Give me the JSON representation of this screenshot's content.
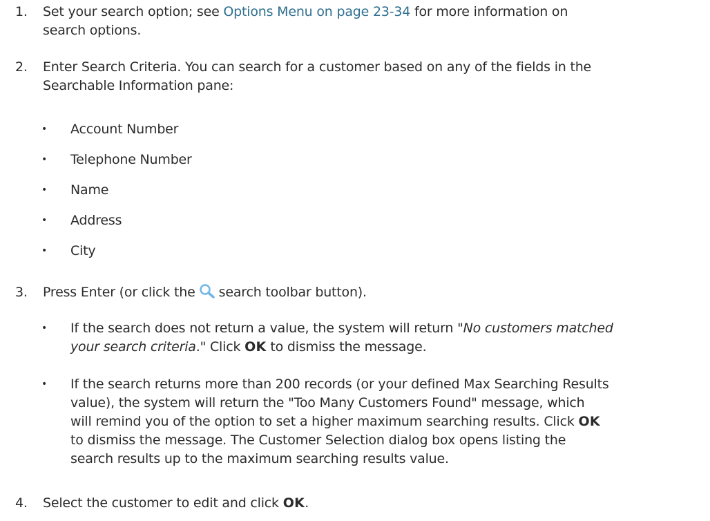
{
  "steps": [
    {
      "num": "1.",
      "before_link": "Set your search option; see ",
      "link": "Options Menu on page 23-34",
      "after_link": " for more information on",
      "line2": "search options."
    },
    {
      "num": "2.",
      "line1": "Enter Search Criteria. You can search for a customer based on any of the fields in the",
      "line2": "Searchable Information pane:",
      "bullets": [
        "Account Number",
        "Telephone Number",
        "Name",
        "Address",
        "City"
      ]
    },
    {
      "num": "3.",
      "before_icon": "Press Enter (or click the",
      "after_icon": "search toolbar button).",
      "icon": "search-icon",
      "sub_a": {
        "pre": "If the search does not return a value, the system will return ",
        "italic_1": "\"No customers matched",
        "italic_2": "your search criteria",
        "post": ".\" Click ",
        "ok": "OK",
        "end": " to dismiss the message."
      },
      "sub_b": {
        "line1": "If the search returns more than 200 records (or your defined Max Searching Results",
        "line2": "value), the system will return the \"Too Many Customers Found\" message, which",
        "line3_pre": "will remind you of the option to set a higher maximum searching results. Click ",
        "ok": "OK",
        "line4_pre": "to dismiss the message. The Customer Selection dialog box opens listing the",
        "line5": "search results up to the maximum searching results value."
      }
    },
    {
      "num": "4.",
      "pre": "Select the customer to edit and click ",
      "ok": "OK",
      "end": "."
    }
  ],
  "bullet_char": "•",
  "colors": {
    "text": "#2b2b2b",
    "link": "#2f6f8f",
    "icon": "#6fb6e8"
  }
}
